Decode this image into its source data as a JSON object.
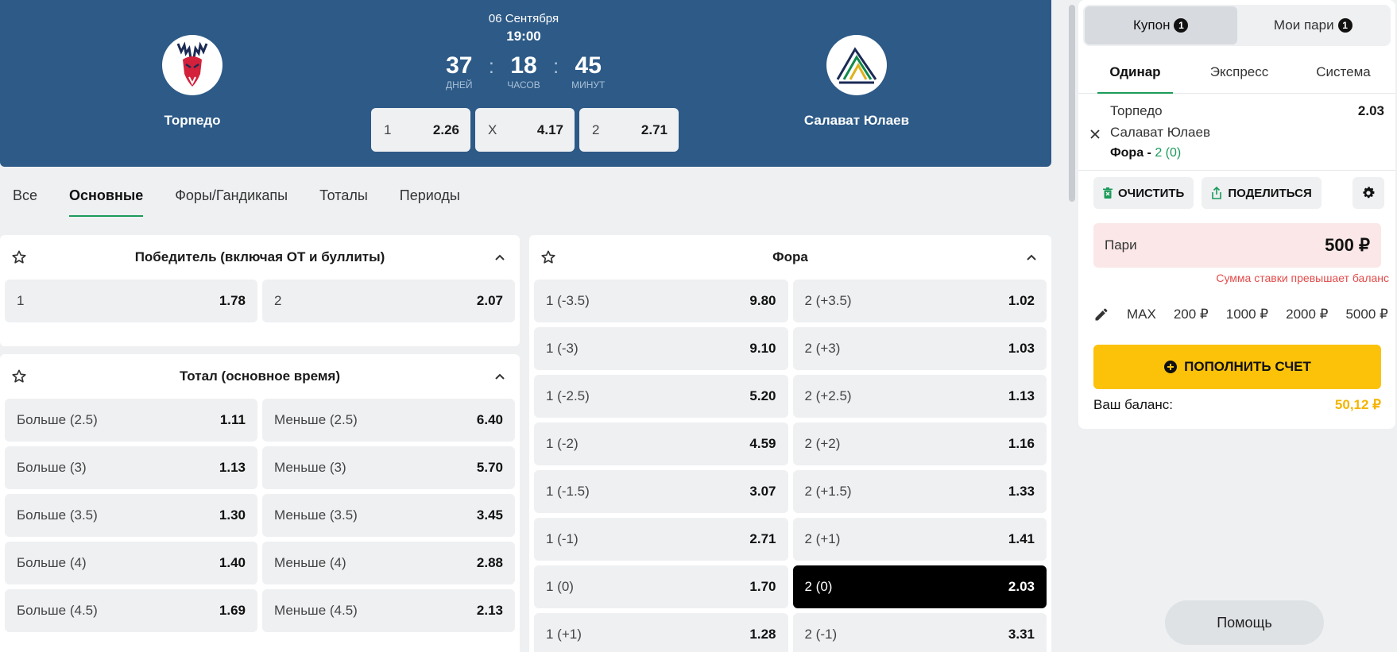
{
  "match": {
    "date": "06 Сентября",
    "time": "19:00",
    "home_team": "Торпедо",
    "away_team": "Салават Юлаев",
    "countdown": {
      "days": "37",
      "days_label": "ДНЕЙ",
      "hours": "18",
      "hours_label": "ЧАСОВ",
      "minutes": "45",
      "minutes_label": "МИНУТ",
      "separator": ":"
    },
    "odds": [
      {
        "label": "1",
        "value": "2.26"
      },
      {
        "label": "X",
        "value": "4.17"
      },
      {
        "label": "2",
        "value": "2.71"
      }
    ]
  },
  "market_tabs": [
    "Все",
    "Основные",
    "Форы/Гандикапы",
    "Тоталы",
    "Периоды"
  ],
  "active_market_tab": "Основные",
  "winner_market": {
    "title": "Победитель (включая ОТ и буллиты)",
    "rows": [
      [
        {
          "label": "1",
          "value": "1.78"
        },
        {
          "label": "2",
          "value": "2.07"
        }
      ]
    ]
  },
  "total_market": {
    "title": "Тотал (основное время)",
    "rows": [
      [
        {
          "label": "Больше (2.5)",
          "value": "1.11"
        },
        {
          "label": "Меньше (2.5)",
          "value": "6.40"
        }
      ],
      [
        {
          "label": "Больше (3)",
          "value": "1.13"
        },
        {
          "label": "Меньше (3)",
          "value": "5.70"
        }
      ],
      [
        {
          "label": "Больше (3.5)",
          "value": "1.30"
        },
        {
          "label": "Меньше (3.5)",
          "value": "3.45"
        }
      ],
      [
        {
          "label": "Больше (4)",
          "value": "1.40"
        },
        {
          "label": "Меньше (4)",
          "value": "2.88"
        }
      ],
      [
        {
          "label": "Больше (4.5)",
          "value": "1.69"
        },
        {
          "label": "Меньше (4.5)",
          "value": "2.13"
        }
      ]
    ]
  },
  "handicap_market": {
    "title": "Фора",
    "rows": [
      [
        {
          "label": "1 (-3.5)",
          "value": "9.80"
        },
        {
          "label": "2 (+3.5)",
          "value": "1.02"
        }
      ],
      [
        {
          "label": "1 (-3)",
          "value": "9.10"
        },
        {
          "label": "2 (+3)",
          "value": "1.03"
        }
      ],
      [
        {
          "label": "1 (-2.5)",
          "value": "5.20"
        },
        {
          "label": "2 (+2.5)",
          "value": "1.13"
        }
      ],
      [
        {
          "label": "1 (-2)",
          "value": "4.59"
        },
        {
          "label": "2 (+2)",
          "value": "1.16"
        }
      ],
      [
        {
          "label": "1 (-1.5)",
          "value": "3.07"
        },
        {
          "label": "2 (+1.5)",
          "value": "1.33"
        }
      ],
      [
        {
          "label": "1 (-1)",
          "value": "2.71"
        },
        {
          "label": "2 (+1)",
          "value": "1.41"
        }
      ],
      [
        {
          "label": "1 (0)",
          "value": "1.70"
        },
        {
          "label": "2 (0)",
          "value": "2.03",
          "selected": true
        }
      ],
      [
        {
          "label": "1 (+1)",
          "value": "1.28"
        },
        {
          "label": "2 (-1)",
          "value": "3.31"
        }
      ]
    ]
  },
  "coupon": {
    "tabs": [
      {
        "label": "Купон",
        "badge": "1"
      },
      {
        "label": "Мои пари",
        "badge": "1"
      }
    ],
    "bet_types": [
      "Одинар",
      "Экспресс",
      "Система"
    ],
    "selection": {
      "home": "Торпедо",
      "away": "Салават Юлаев",
      "market": "Фора - ",
      "pick": "2 (0)",
      "odd": "2.03"
    },
    "clear_label": "ОЧИСТИТЬ",
    "share_label": "ПОДЕЛИТЬСЯ",
    "stake_label": "Пари",
    "stake_value": "500 ₽",
    "stake_warning": "Сумма ставки превышает баланс",
    "quick_stakes": [
      "MAX",
      "200 ₽",
      "1000 ₽",
      "2000 ₽",
      "5000 ₽"
    ],
    "topup_label": "ПОПОЛНИТЬ СЧЕТ",
    "balance_label": "Ваш баланс:",
    "balance_value": "50,12 ₽"
  },
  "help_label": "Помощь",
  "colors": {
    "header_bg": "#2d5a87",
    "accent_green": "#1a9b5a",
    "topup_yellow": "#fcc20a",
    "balance_yellow": "#f4b400",
    "warning_red": "#e34b4b"
  }
}
